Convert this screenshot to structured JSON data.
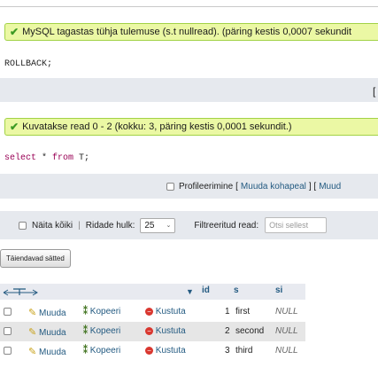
{
  "messages": {
    "first": "MySQL tagastas tühja tulemuse (s.t nullread). (päring kestis 0,0007 sekundit",
    "second": "Kuvatakse read 0 - 2 (kokku: 3, päring kestis 0,0001 sekundit.)"
  },
  "queries": {
    "rollback": "ROLLBACK;",
    "select_kw1": "select",
    "select_star": " * ",
    "select_kw2": "from",
    "select_rest": " T;"
  },
  "bracket_char": "[",
  "profiling": {
    "label": "Profileerimine",
    "open": "[",
    "edit_inline": "Muuda kohapeal",
    "mid": "] [",
    "edit_more": "Muud"
  },
  "controls": {
    "show_all": "Näita kõiki",
    "sep": "|",
    "rows_label": "Ridade hulk:",
    "rows_value": "25",
    "filter_label": "Filtreeritud read:",
    "filter_placeholder": "Otsi sellest"
  },
  "extra_button": "Täiendavad sätted",
  "table": {
    "columns": [
      "id",
      "s",
      "si"
    ],
    "actions": {
      "edit": "Muuda",
      "copy": "Kopeeri",
      "delete": "Kustuta"
    },
    "rows": [
      {
        "id": "1",
        "s": "first",
        "si": "NULL"
      },
      {
        "id": "2",
        "s": "second",
        "si": "NULL"
      },
      {
        "id": "3",
        "s": "third",
        "si": "NULL"
      }
    ]
  },
  "colors": {
    "success_bg": "#ebf8a4",
    "success_border": "#a2d246",
    "link": "#235a81",
    "row_highlight": "#e6e6e6"
  }
}
